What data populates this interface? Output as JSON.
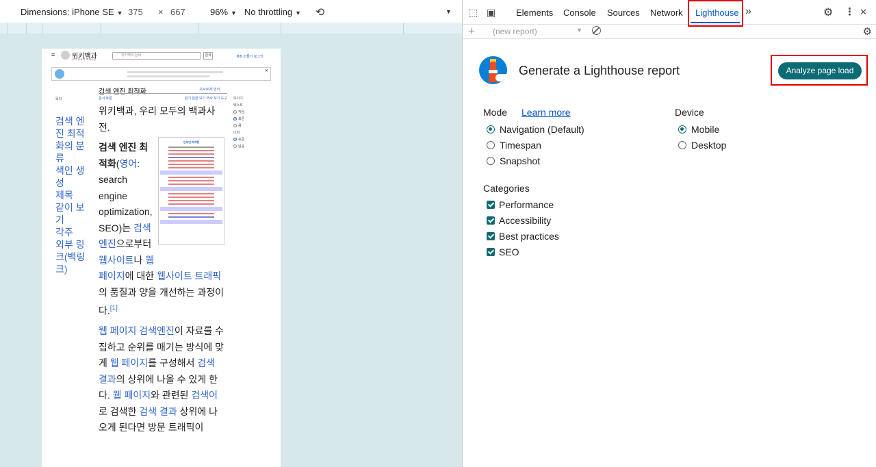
{
  "device_toolbar": {
    "dimensions_label": "Dimensions: iPhone SE",
    "width": "375",
    "times": "×",
    "height": "667",
    "zoom": "96%",
    "throttle": "No throttling"
  },
  "wiki": {
    "logo_name": "위키백과",
    "logo_sub": "우리 모두의 백과사전",
    "search_placeholder": "위키백과 검색",
    "search_button": "검색",
    "login_links": "계정 만들기 로그인",
    "article_title": "검색 엔진 최적화",
    "lang_link": "文A 66개 언어",
    "toc_head": "목차",
    "toc_items": [
      "검색 엔진 최적화의 분류",
      "색인 생성",
      "제목",
      "같이 보기",
      "각주",
      "외부 링크(백링크)"
    ],
    "tabs_left": "문서 토론",
    "tabs_right": "읽기 원본 보기 역사 보기 도구",
    "side_head": "보이기",
    "side_text": "텍스트",
    "side_small": "작음",
    "side_standard": "표준",
    "side_large": "큼",
    "side_width": "너비",
    "side_wide": "넓음",
    "infobox_title": "인터넷 마케팅",
    "body": {
      "p1": "위키백과, 우리 모두의 백과사전.",
      "term_bold": "검색 엔진 최적화",
      "term_paren_open": "(",
      "term_lang": "영어",
      "term_en": ": search engine optimization, SEO)는 ",
      "link_search_engine": "검색 엔진",
      "t1": "으로부터 ",
      "link_website": "웹사이트",
      "t2": "나 ",
      "link_webpage": "웹페이지",
      "t3": "에 대한 ",
      "link_traffic": "웹사이트 트래픽",
      "t4": "의 품질과 양을 개선하는 과정이다.",
      "ref1": "[1]",
      "p3_link1": "웹 페이지",
      "p3_link2": "검색엔진",
      "p3_t1": "이 자료를 수집하고 순위를 매기는 방식에 맞게 ",
      "p3_link3": "웹 페이지",
      "p3_t2": "를 구성해서 ",
      "p3_link4": "검색 결과",
      "p3_t3": "의 상위에 나올 수 있게 한다. ",
      "p3_link5": "웹 페이지",
      "p3_t4": "와 관련된 ",
      "p3_link6": "검색어",
      "p3_t5": "로 검색한 ",
      "p3_link7": "검색 결과",
      "p3_t6": " 상위에 나오게 된다면 방문 트래픽이"
    }
  },
  "devtools": {
    "tabs": [
      "Elements",
      "Console",
      "Sources",
      "Network",
      "Lighthouse"
    ],
    "active_tab": "Lighthouse",
    "more": "»",
    "close": "✕",
    "report_select": "(new report)",
    "title": "Generate a Lighthouse report",
    "analyze_button": "Analyze page load",
    "mode_label": "Mode",
    "learn_more": "Learn more",
    "modes": [
      "Navigation (Default)",
      "Timespan",
      "Snapshot"
    ],
    "device_label": "Device",
    "devices": [
      "Mobile",
      "Desktop"
    ],
    "categories_label": "Categories",
    "categories": [
      "Performance",
      "Accessibility",
      "Best practices",
      "SEO"
    ],
    "colors": {
      "accent": "#0d6b75",
      "highlight": "#e00000",
      "active_tab": "#0b57d0"
    }
  }
}
